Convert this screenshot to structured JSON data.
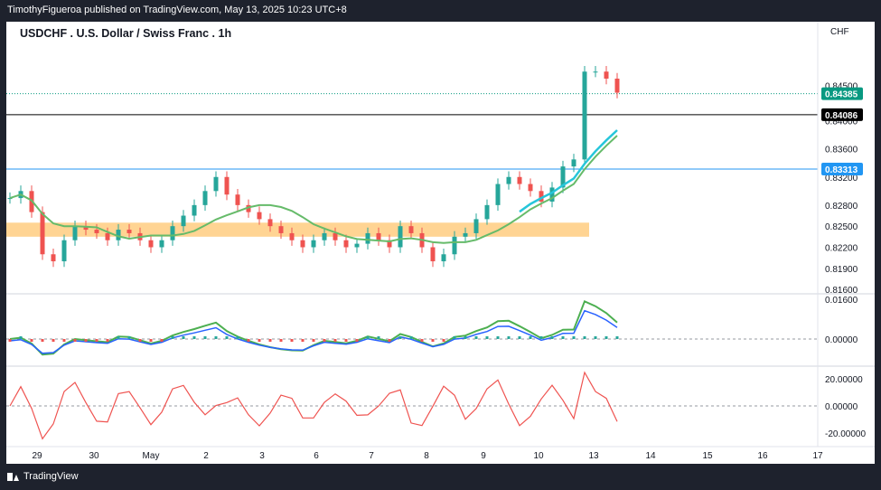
{
  "header": {
    "published_by": "TimothyFigueroa published on TradingView.com, May 13, 2025 10:23 UTC+8"
  },
  "footer": {
    "brand": "TradingView"
  },
  "chart_data": {
    "type": "candlestick",
    "title": "USDCHF . U.S. Dollar / Swiss Franc . 1h",
    "currency": "CHF",
    "x_ticks": [
      "29",
      "30",
      "May",
      "2",
      "3",
      "6",
      "7",
      "8",
      "9",
      "10",
      "13",
      "14",
      "15",
      "16",
      "17"
    ],
    "price_axis": {
      "ticks": [
        "0.84500",
        "0.84000",
        "0.83600",
        "0.83200",
        "0.82800",
        "0.82500",
        "0.82200",
        "0.81900",
        "0.81600"
      ],
      "range": [
        0.8155,
        0.8505
      ]
    },
    "price_labels": [
      {
        "value": "0.84385",
        "color": "#089981"
      },
      {
        "value": "0.84086",
        "color": "#000000"
      },
      {
        "value": "0.83313",
        "color": "#2196f3"
      }
    ],
    "support_zone": {
      "from": 0.8235,
      "to": 0.8255,
      "color": "#ffcc80"
    },
    "moving_averages": [
      {
        "color": "#66bb6a"
      },
      {
        "color": "#26c6da"
      }
    ],
    "candles_approx_close": [
      0.829,
      0.83,
      0.827,
      0.821,
      0.82,
      0.823,
      0.825,
      0.8245,
      0.824,
      0.823,
      0.8245,
      0.824,
      0.823,
      0.822,
      0.823,
      0.825,
      0.8265,
      0.828,
      0.83,
      0.832,
      0.8295,
      0.828,
      0.827,
      0.826,
      0.825,
      0.824,
      0.823,
      0.822,
      0.823,
      0.824,
      0.823,
      0.822,
      0.8225,
      0.824,
      0.823,
      0.822,
      0.825,
      0.824,
      0.822,
      0.82,
      0.821,
      0.8235,
      0.824,
      0.826,
      0.828,
      0.831,
      0.832,
      0.831,
      0.83,
      0.8285,
      0.8305,
      0.8335,
      0.8345,
      0.847,
      0.847,
      0.846,
      0.844
    ],
    "oscillator_1": {
      "ticks": [
        "0.01600",
        "0.00000"
      ]
    },
    "oscillator_2": {
      "ticks": [
        "20.00000",
        "0.00000",
        "-20.00000"
      ]
    }
  }
}
